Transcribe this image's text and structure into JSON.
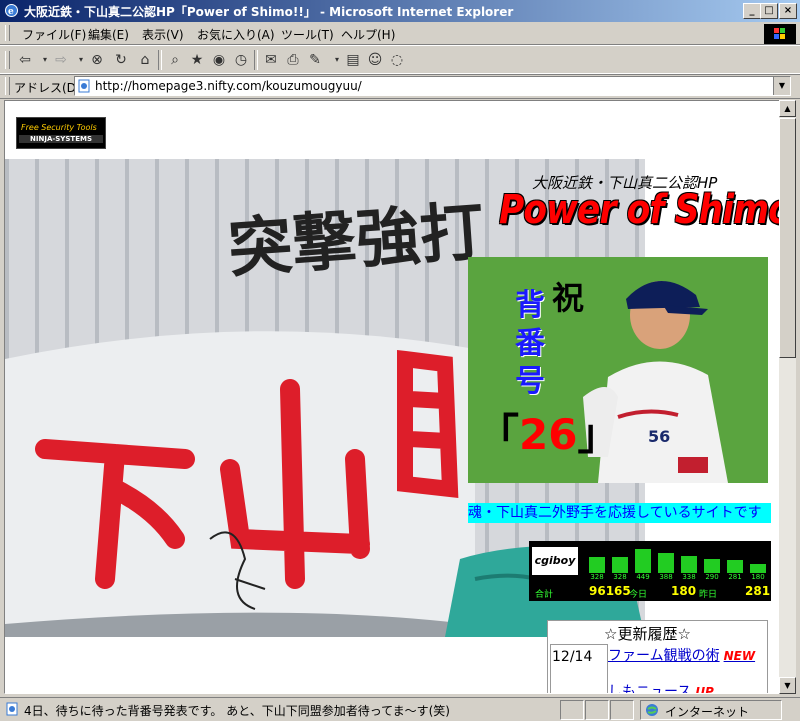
{
  "window": {
    "title": "大阪近鉄・下山真二公認HP「Power of Shimo!!」 - Microsoft Internet Explorer"
  },
  "menu": [
    "ファイル(F)",
    "編集(E)",
    "表示(V)",
    "お気に入り(A)",
    "ツール(T)",
    "ヘルプ(H)"
  ],
  "address": {
    "label": "アドレス(D)",
    "url": "http://homepage3.nifty.com/kouzumougyuu/"
  },
  "page": {
    "ninja": {
      "line1": "Free Security Tools",
      "line2": "NINJA-SYSTEMS"
    },
    "banner_text": "突撃強打",
    "subtitle": "大阪近鉄・下山真二公認HP",
    "title": "Power of Shimo!!",
    "iwai": "祝",
    "senum_label": "背番号",
    "number": "26",
    "marquee": "魂・下山真二外野手を応援しているサイトです",
    "counter": {
      "logo": "cgiboy",
      "counts": [
        "328",
        "328",
        "449",
        "388",
        "338",
        "290",
        "281",
        "180"
      ],
      "total_label": "合計",
      "total": "96165",
      "today_label": "今日",
      "today": "180",
      "yesterday_label": "昨日",
      "yesterday": "281"
    },
    "history": {
      "header": "☆更新履歴☆",
      "date": "12/14",
      "item1": "ファーム観戦の術",
      "item1_badge": "NEW",
      "item2": "しもニュース",
      "item2_badge": "UP"
    }
  },
  "status": {
    "text": "4日、待ちに待った背番号発表です。 あと、下山下同盟参加者待ってま～す(笑)",
    "zone": "インターネット"
  },
  "colors": {
    "title_red": "#ff0000",
    "marquee_bg": "#00ffff",
    "marquee_text": "#0000ff",
    "link": "#0000cc"
  }
}
